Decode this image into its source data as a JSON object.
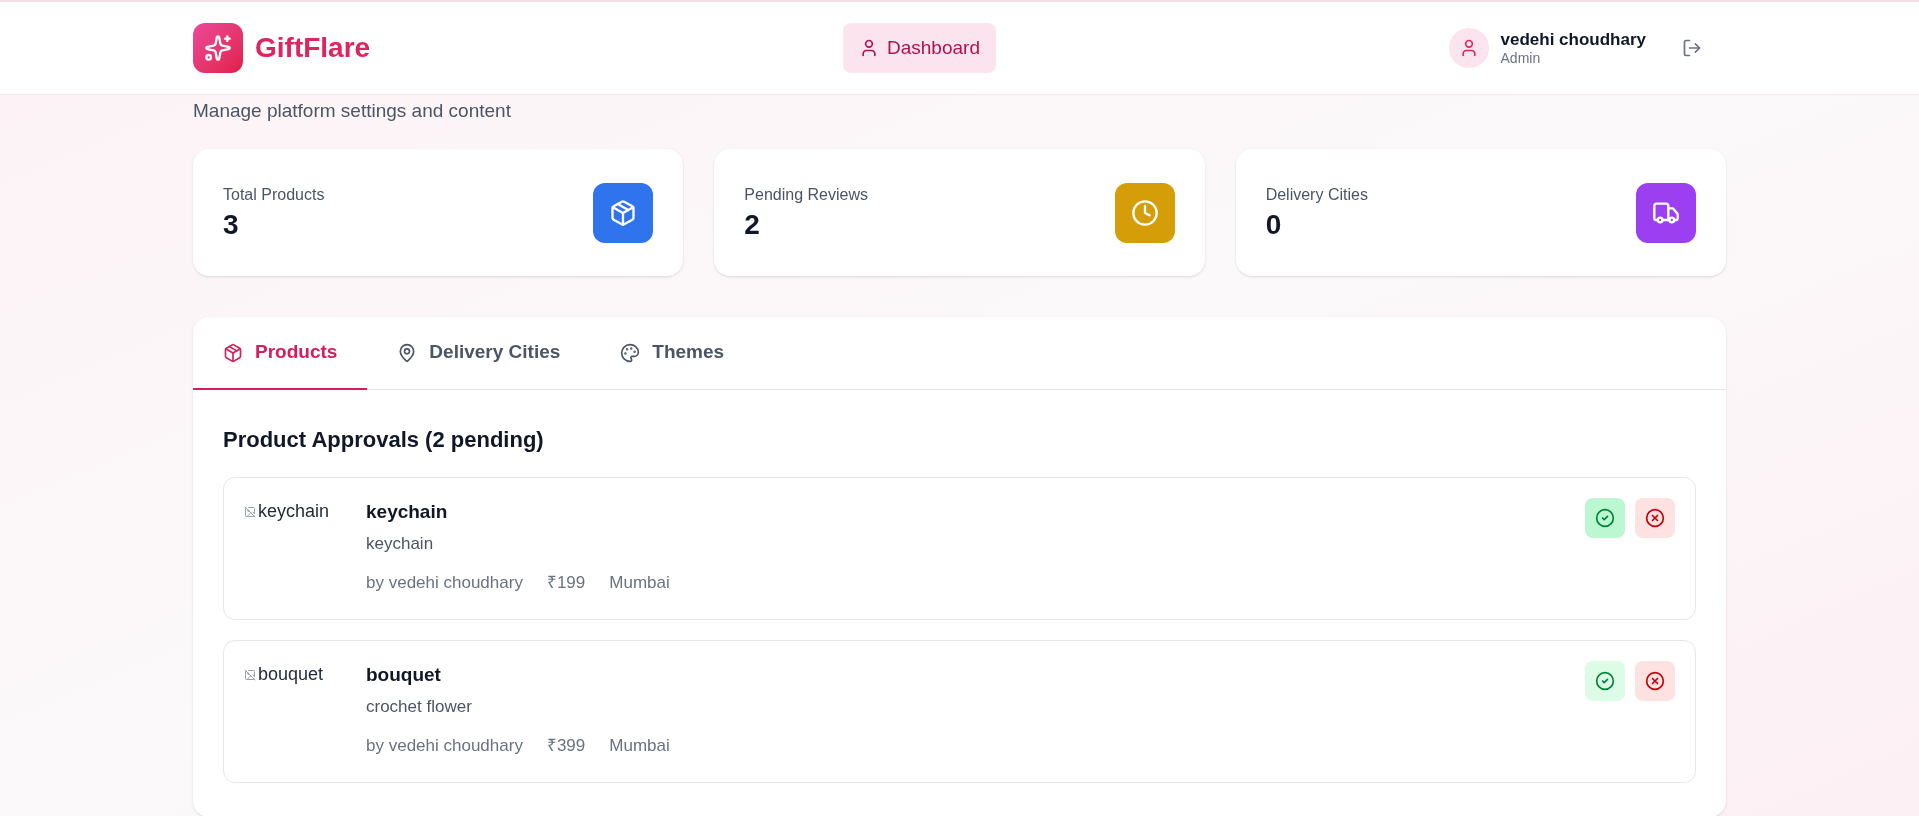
{
  "header": {
    "brand": "GiftFlare",
    "nav": [
      {
        "label": "Dashboard",
        "selected": true
      }
    ],
    "user": {
      "name": "vedehi choudhary",
      "role": "Admin"
    }
  },
  "page": {
    "subtitle": "Manage platform settings and content"
  },
  "stats": [
    {
      "label": "Total Products",
      "value": "3",
      "kind": "box",
      "color": "#2f74ec"
    },
    {
      "label": "Pending Reviews",
      "value": "2",
      "kind": "clock",
      "color": "#d59d08"
    },
    {
      "label": "Delivery Cities",
      "value": "0",
      "kind": "truck",
      "color": "#9b3ff0"
    }
  ],
  "tabs": [
    {
      "label": "Products",
      "kind": "box",
      "selected": true
    },
    {
      "label": "Delivery Cities",
      "kind": "pin",
      "selected": false
    },
    {
      "label": "Themes",
      "kind": "palette",
      "selected": false
    }
  ],
  "approvals": {
    "heading": "Product Approvals (2 pending)",
    "items": [
      {
        "image_alt": "keychain",
        "name": "keychain",
        "description": "keychain",
        "seller": "by vedehi choudhary",
        "price": "₹199",
        "city": "Mumbai",
        "approve_hovered": true
      },
      {
        "image_alt": "bouquet",
        "name": "bouquet",
        "description": "crochet flower",
        "seller": "by vedehi choudhary",
        "price": "₹399",
        "city": "Mumbai",
        "approve_hovered": false
      }
    ]
  }
}
